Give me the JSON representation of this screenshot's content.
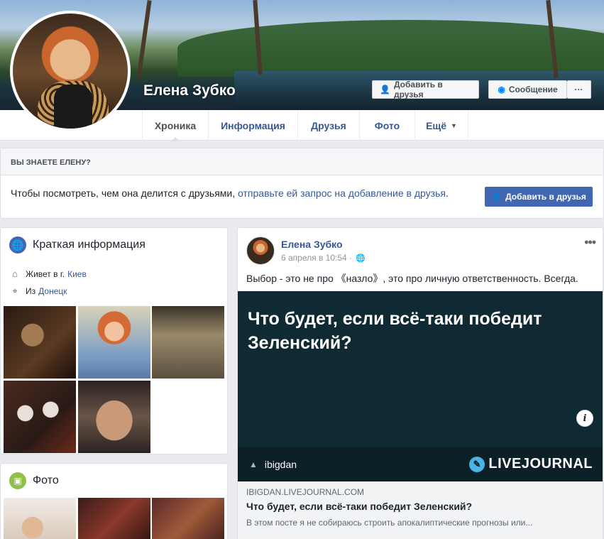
{
  "profile": {
    "name": "Елена Зубко",
    "add_friend_label": "Добавить в друзья",
    "message_label": "Сообщение",
    "more_label": "···"
  },
  "tabs": [
    {
      "label": "Хроника",
      "active": true
    },
    {
      "label": "Информация"
    },
    {
      "label": "Друзья"
    },
    {
      "label": "Фото"
    },
    {
      "label": "Ещё"
    }
  ],
  "know": {
    "heading": "ВЫ ЗНАЕТЕ ЕЛЕНУ?",
    "text": "Чтобы посмотреть, чем она делится с друзьями,",
    "link": "отправьте ей запрос на добавление в друзья",
    "button": "Добавить в друзья"
  },
  "intro": {
    "title": "Краткая информация",
    "lives_prefix": "Живет в г.",
    "lives_city": "Киев",
    "from_prefix": "Из",
    "from_city": "Донецк"
  },
  "photos": {
    "title": "Фото"
  },
  "post": {
    "author": "Елена Зубко",
    "time": "6 апреля в 10:54 ·",
    "more": "•••",
    "text": "Выбор - это не про 《назло》, это про личную ответственность. Всегда.",
    "image_headline": "Что будет, если всё-таки победит Зеленский?",
    "image_user": "ibigdan",
    "image_brand": "LIVEJOURNAL",
    "info": "i",
    "link_domain": "IBIGDAN.LIVEJOURNAL.COM",
    "link_title": "Что будет, если всё-таки победит Зеленский?",
    "link_desc": "В этом посте я не собираюсь строить апокалиптические прогнозы или..."
  },
  "colors": {
    "brand_blue": "#4267b2",
    "link_blue": "#365899",
    "background": "#e9ebee"
  }
}
